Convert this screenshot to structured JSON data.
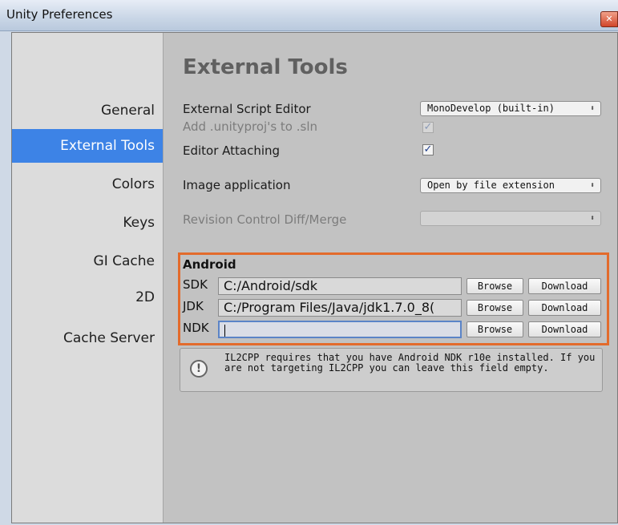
{
  "window": {
    "title": "Unity Preferences"
  },
  "sidebar": {
    "items": [
      {
        "label": "General"
      },
      {
        "label": "External Tools"
      },
      {
        "label": "Colors"
      },
      {
        "label": "Keys"
      },
      {
        "label": "GI Cache"
      },
      {
        "label": "2D"
      },
      {
        "label": "Cache Server"
      }
    ],
    "active_index": 1
  },
  "main": {
    "heading": "External Tools",
    "external_script_editor": {
      "label": "External Script Editor",
      "value": "MonoDevelop (built-in)"
    },
    "add_unityproj": {
      "label": "Add .unityproj's to .sln",
      "checked": true,
      "enabled": false
    },
    "editor_attaching": {
      "label": "Editor Attaching",
      "checked": true
    },
    "image_application": {
      "label": "Image application",
      "value": "Open by file extension"
    },
    "revision_control": {
      "label": "Revision Control Diff/Merge",
      "value": ""
    },
    "android": {
      "title": "Android",
      "sdk": {
        "label": "SDK",
        "path": "C:/Android/sdk"
      },
      "jdk": {
        "label": "JDK",
        "path": "C:/Program Files/Java/jdk1.7.0_8("
      },
      "ndk": {
        "label": "NDK",
        "path": ""
      },
      "browse_label": "Browse",
      "download_label": "Download"
    },
    "help": {
      "icon": "info-icon",
      "text": "IL2CPP requires that you have Android NDK r10e installed. If you are not targeting IL2CPP you can leave this field empty."
    }
  },
  "colors": {
    "accent": "#3d83e6",
    "highlight_border": "#e36b2c"
  }
}
